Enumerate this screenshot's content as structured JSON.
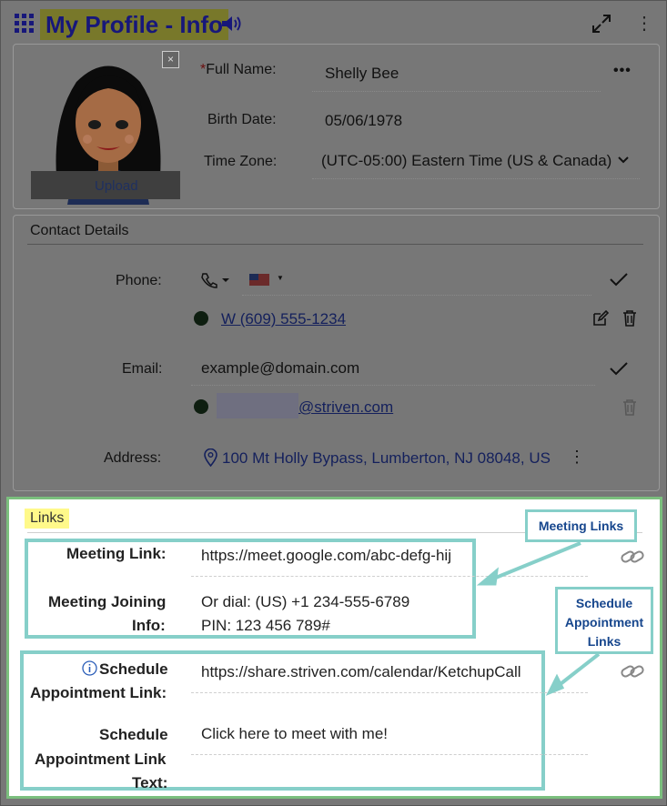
{
  "header": {
    "title": "My Profile - Info"
  },
  "profile": {
    "close_label": "×",
    "upload_label": "Upload",
    "full_name_label": "Full Name:",
    "required_mark": "*",
    "full_name_value": "Shelly Bee",
    "more_label": "•••",
    "birth_date_label": "Birth Date:",
    "birth_date_value": "05/06/1978",
    "time_zone_label": "Time Zone:",
    "time_zone_value": "(UTC-05:00) Eastern Time (US & Canada)"
  },
  "contact": {
    "section_title": "Contact Details",
    "phone_label": "Phone:",
    "phone_value": "W (609) 555-1234",
    "email_label": "Email:",
    "email_input_value": "example@domain.com",
    "email_saved_suffix": "@striven.com",
    "address_label": "Address:",
    "address_value": "100 Mt Holly Bypass, Lumberton, NJ 08048, US",
    "address_more": "⋮"
  },
  "links": {
    "section_title": "Links",
    "meeting_link_label": "Meeting Link:",
    "meeting_link_value": "https://meet.google.com/abc-defg-hij",
    "meeting_joining_label_line1": "Meeting Joining",
    "meeting_joining_label_line2": "Info:",
    "meeting_joining_line1": "Or dial: (US) +1 234-555-6789",
    "meeting_joining_line2": "PIN: 123 456 789#",
    "schedule_link_label_line1": "Schedule",
    "schedule_link_label_line2": "Appointment Link:",
    "schedule_link_value": "https://share.striven.com/calendar/KetchupCall",
    "schedule_text_label_line1": "Schedule",
    "schedule_text_label_line2": "Appointment Link",
    "schedule_text_label_line3": "Text:",
    "schedule_text_value": "Click here to meet with me!"
  },
  "callouts": {
    "meeting_links": "Meeting Links",
    "schedule_line1": "Schedule",
    "schedule_line2": "Appointment",
    "schedule_line3": "Links"
  },
  "colors": {
    "title_bg": "#78782a",
    "title_text": "#17177a",
    "callout_border": "#86cfc9",
    "callout_text": "#16468d",
    "links_border": "#7bbf7e",
    "links_title_bg": "#fff98a"
  },
  "icons": [
    "grid-icon",
    "speaker-icon",
    "expand-icon",
    "kebab-icon",
    "close-icon",
    "chevron-down-icon",
    "phone-icon",
    "flag-icon",
    "check-icon",
    "edit-icon",
    "trash-icon",
    "map-pin-icon",
    "chain-link-icon",
    "info-icon"
  ]
}
